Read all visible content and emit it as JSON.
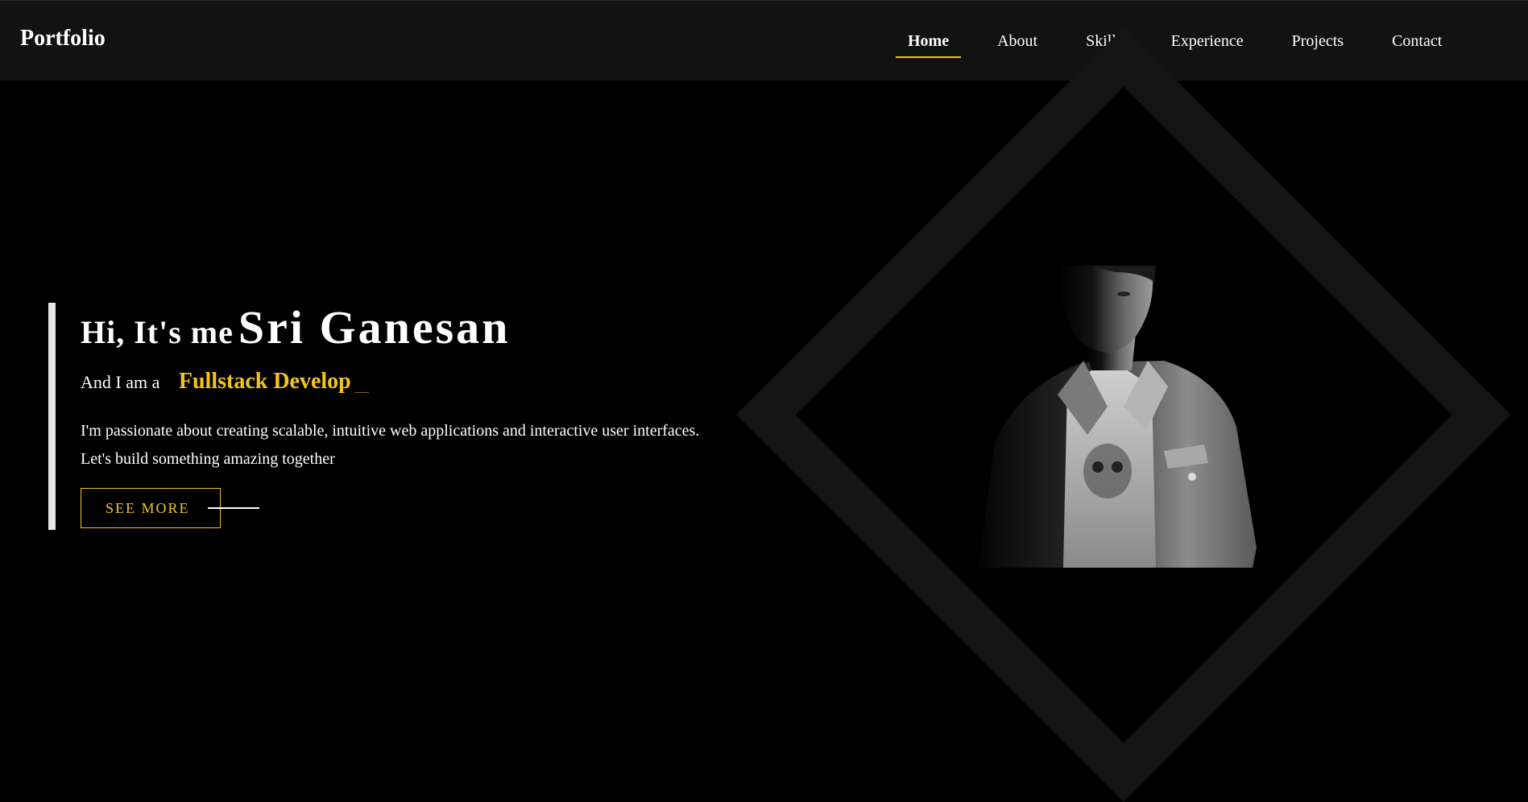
{
  "nav": {
    "logo": "Portfolio",
    "links": [
      {
        "label": "Home",
        "active": true
      },
      {
        "label": "About",
        "active": false
      },
      {
        "label": "Skills",
        "active": false
      },
      {
        "label": "Experience",
        "active": false
      },
      {
        "label": "Projects",
        "active": false
      },
      {
        "label": "Contact",
        "active": false
      }
    ]
  },
  "hero": {
    "greeting": "Hi, It's me",
    "name": "Sri Ganesan",
    "role_prefix": "And I am a",
    "role": "Fullstack Develop",
    "description": "I'm passionate about creating scalable, intuitive web applications and interactive user interfaces. Let's build something amazing together",
    "button_label": "SEE MORE"
  },
  "colors": {
    "accent": "#f5c518",
    "background": "#000000",
    "navbar": "#121212",
    "diamond": "#141414"
  }
}
